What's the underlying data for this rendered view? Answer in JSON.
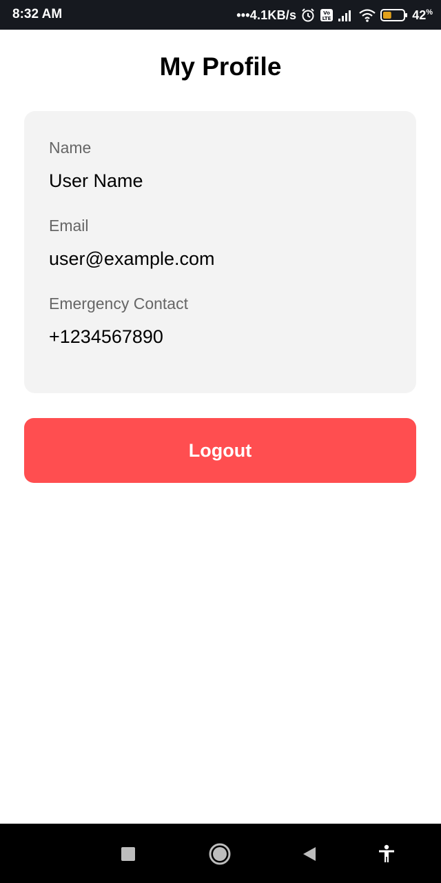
{
  "status_bar": {
    "time": "8:32 AM",
    "network_speed": "•••4.1KB/s",
    "battery_percent": "42",
    "battery_unit": "%",
    "battery_level": 0.42,
    "icons": [
      "alarm-icon",
      "volte-icon",
      "signal-icon",
      "wifi-icon",
      "battery-icon"
    ]
  },
  "header": {
    "title": "My Profile"
  },
  "profile": {
    "fields": [
      {
        "label": "Name",
        "value": "User Name"
      },
      {
        "label": "Email",
        "value": "user@example.com"
      },
      {
        "label": "Emergency Contact",
        "value": "+1234567890"
      }
    ]
  },
  "actions": {
    "logout_label": "Logout"
  },
  "nav_bar": {
    "icons": [
      "recents-square-icon",
      "home-circle-icon",
      "back-triangle-icon",
      "accessibility-icon"
    ]
  },
  "colors": {
    "logout_button": "#ff4e50",
    "card_background": "#f3f3f3",
    "status_bar": "#16191f",
    "battery_fill": "#e2a11c"
  }
}
